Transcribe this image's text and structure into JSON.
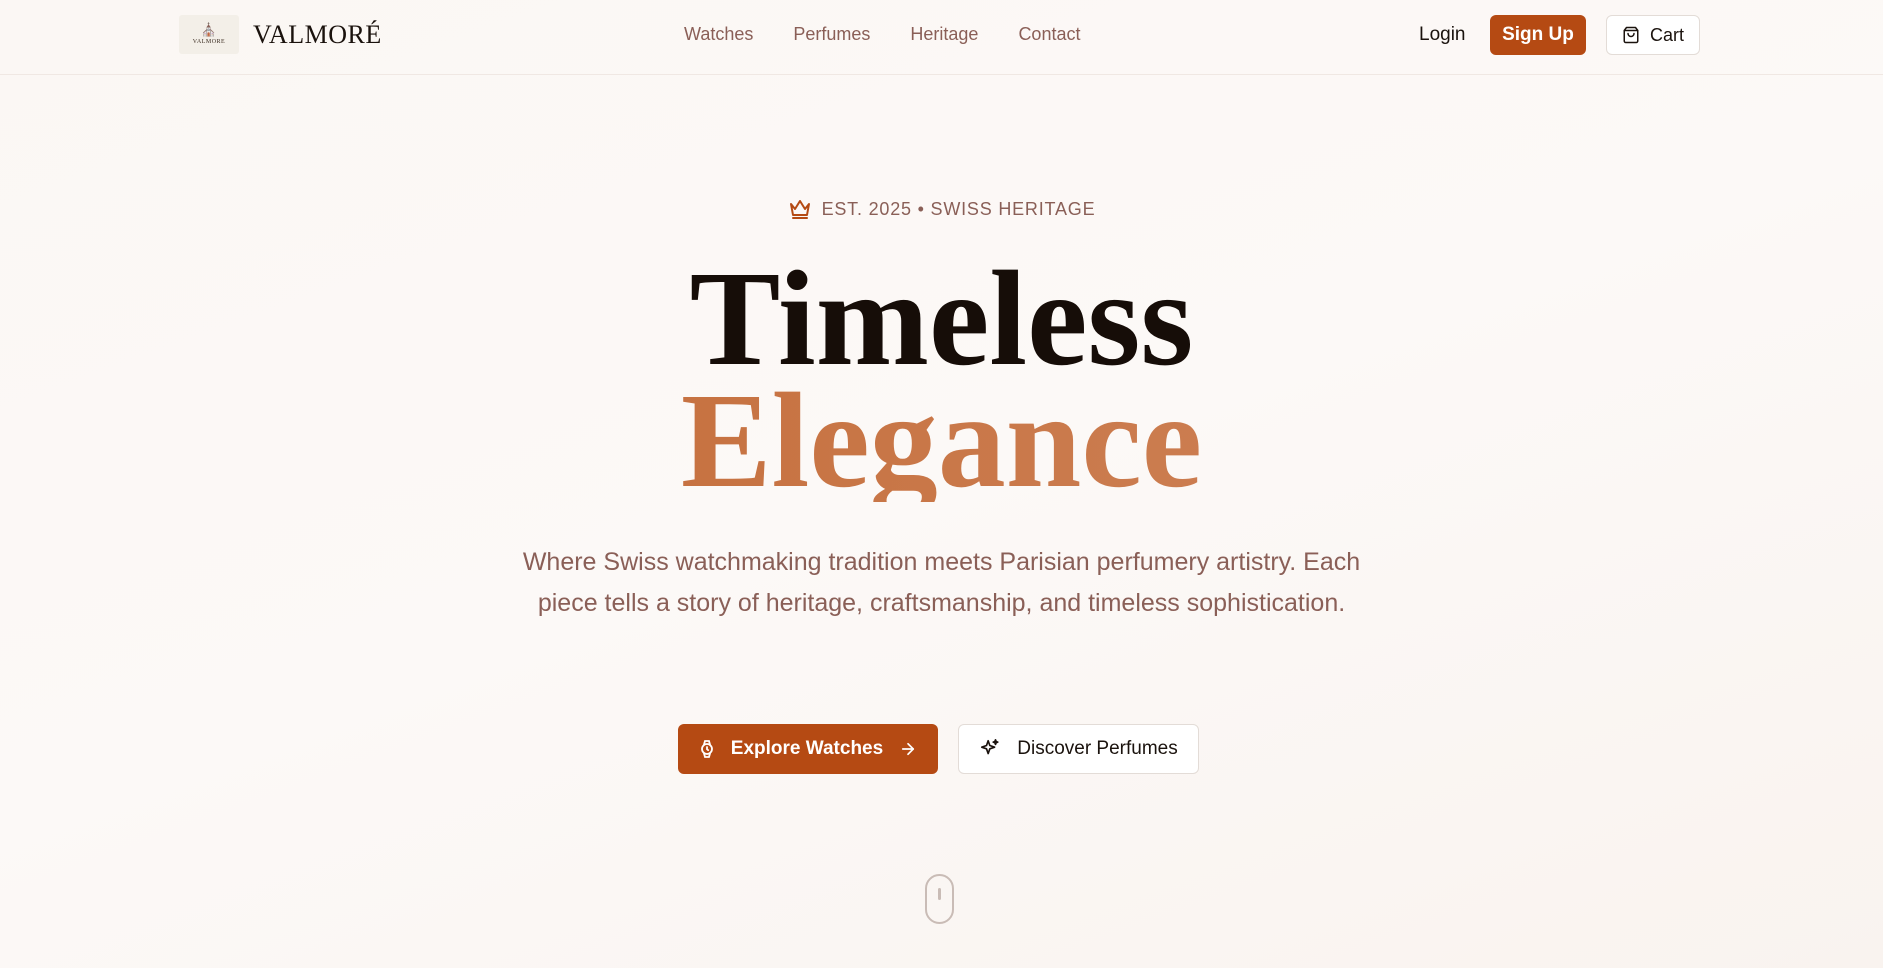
{
  "brand": {
    "name": "VALMORÉ",
    "logo_text": "VALMORE",
    "logo_glyph": "⛪"
  },
  "nav": {
    "links": [
      "Watches",
      "Perfumes",
      "Heritage",
      "Contact"
    ],
    "login_label": "Login",
    "signup_label": "Sign Up",
    "cart_label": "Cart"
  },
  "hero": {
    "eyebrow": "EST. 2025 • SWISS HERITAGE",
    "headline_line1": "Timeless",
    "headline_line2": "Elegance",
    "subtitle": "Where Swiss watchmaking tradition meets Parisian perfumery artistry. Each piece tells a story of heritage, craftsmanship, and timeless sophistication.",
    "primary_cta": "Explore Watches",
    "secondary_cta": "Discover Perfumes"
  },
  "icons": {
    "crown": "crown-icon",
    "watch": "watch-icon",
    "arrow": "arrow-right-icon",
    "sparkle": "sparkle-icon",
    "cart": "shopping-bag-icon",
    "scroll": "scroll-indicator-icon"
  },
  "colors": {
    "accent": "#b54a13",
    "headline_dark": "#160d08",
    "headline_accent": "#c0652f",
    "muted_text": "#8a5f57"
  }
}
